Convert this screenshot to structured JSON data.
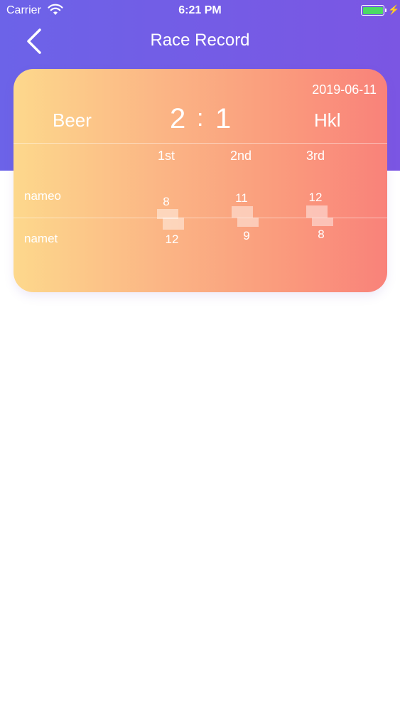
{
  "status_bar": {
    "carrier": "Carrier",
    "time": "6:21 PM"
  },
  "nav": {
    "title": "Race Record"
  },
  "card": {
    "date": "2019-06-11",
    "team_left": "Beer",
    "team_right": "Hkl",
    "score_left": "2",
    "score_sep": ":",
    "score_right": "1",
    "columns": [
      "1st",
      "2nd",
      "3rd"
    ],
    "rows": [
      {
        "name": "nameo",
        "values": [
          "8",
          "11",
          "12"
        ]
      },
      {
        "name": "namet",
        "values": [
          "12",
          "9",
          "8"
        ]
      }
    ]
  },
  "colors": {
    "header": "#6c63e8",
    "card_start": "#fdd88c",
    "card_end": "#f9827a"
  }
}
